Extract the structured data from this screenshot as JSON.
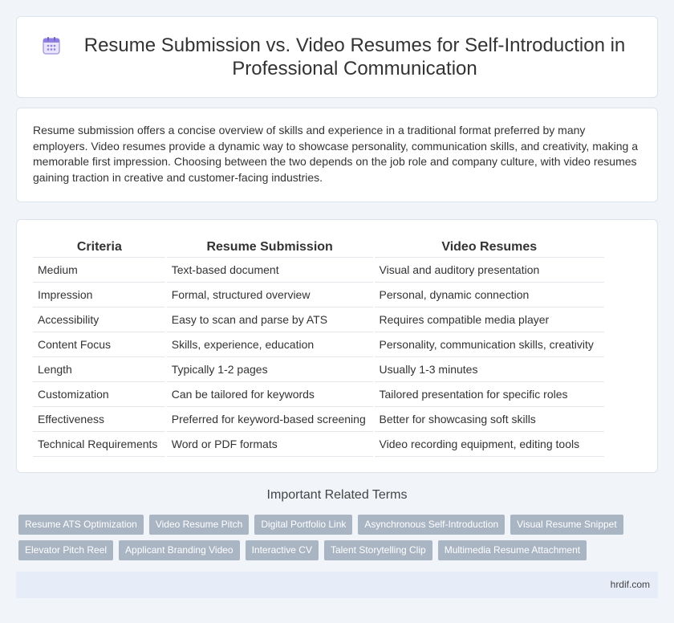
{
  "header": {
    "title": "Resume Submission vs. Video Resumes for Self-Introduction in Professional Communication",
    "icon": "calendar-icon"
  },
  "intro": {
    "text": "Resume submission offers a concise overview of skills and experience in a traditional format preferred by many employers. Video resumes provide a dynamic way to showcase personality, communication skills, and creativity, making a memorable first impression. Choosing between the two depends on the job role and company culture, with video resumes gaining traction in creative and customer-facing industries."
  },
  "table": {
    "headers": [
      "Criteria",
      "Resume Submission",
      "Video Resumes"
    ],
    "rows": [
      [
        "Medium",
        "Text-based document",
        "Visual and auditory presentation"
      ],
      [
        "Impression",
        "Formal, structured overview",
        "Personal, dynamic connection"
      ],
      [
        "Accessibility",
        "Easy to scan and parse by ATS",
        "Requires compatible media player"
      ],
      [
        "Content Focus",
        "Skills, experience, education",
        "Personality, communication skills, creativity"
      ],
      [
        "Length",
        "Typically 1-2 pages",
        "Usually 1-3 minutes"
      ],
      [
        "Customization",
        "Can be tailored for keywords",
        "Tailored presentation for specific roles"
      ],
      [
        "Effectiveness",
        "Preferred for keyword-based screening",
        "Better for showcasing soft skills"
      ],
      [
        "Technical Requirements",
        "Word or PDF formats",
        "Video recording equipment, editing tools"
      ]
    ]
  },
  "related": {
    "title": "Important Related Terms",
    "tags": [
      "Resume ATS Optimization",
      "Video Resume Pitch",
      "Digital Portfolio Link",
      "Asynchronous Self-Introduction",
      "Visual Resume Snippet",
      "Elevator Pitch Reel",
      "Applicant Branding Video",
      "Interactive CV",
      "Talent Storytelling Clip",
      "Multimedia Resume Attachment"
    ]
  },
  "footer": {
    "site": "hrdif.com"
  },
  "colors": {
    "background": "#f1f4f9",
    "tag": "#aab5c4",
    "footer": "#e6edf8",
    "icon_accent": "#7b6fd6"
  }
}
